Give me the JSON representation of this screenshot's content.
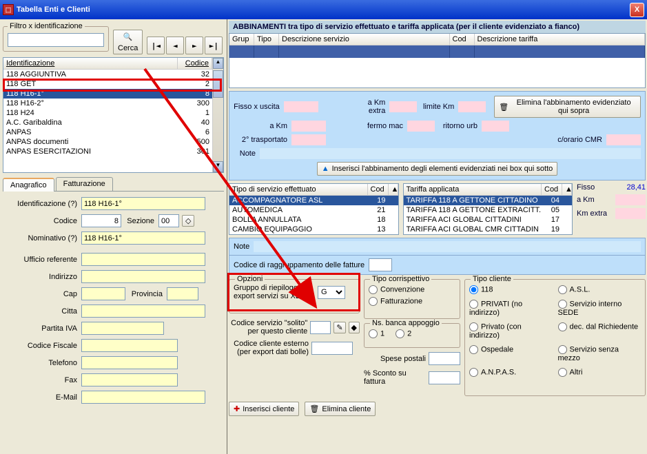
{
  "title": "Tabella Enti e Clienti",
  "filter": {
    "legend": "Filtro x identificazione",
    "search": "Cerca"
  },
  "nav": [
    "|◄",
    "◄",
    "►",
    "►|"
  ],
  "list": {
    "h_ident": "Identificazione",
    "h_code": "Codice",
    "rows": [
      {
        "ident": "118 AGGIUNTIVA",
        "code": "32"
      },
      {
        "ident": "118 GET",
        "code": "2"
      },
      {
        "ident": "118 H16-1°",
        "code": "8",
        "sel": true
      },
      {
        "ident": "118 H16-2°",
        "code": "300"
      },
      {
        "ident": "118 H24",
        "code": "1"
      },
      {
        "ident": "A.C. Garibaldina",
        "code": "40"
      },
      {
        "ident": "ANPAS",
        "code": "6"
      },
      {
        "ident": "ANPAS documenti",
        "code": "500"
      },
      {
        "ident": "ANPAS ESERCITAZIONI",
        "code": "301"
      }
    ]
  },
  "tabs": {
    "t1": "Anagrafico",
    "t2": "Fatturazione"
  },
  "form": {
    "ident_l": "Identificazione (?)",
    "ident_v": "118 H16-1°",
    "code_l": "Codice",
    "code_v": "8",
    "sez_l": "Sezione",
    "sez_v": "00",
    "nom_l": "Nominativo (?)",
    "nom_v": "118 H16-1°",
    "uff_l": "Ufficio referente",
    "ind_l": "Indirizzo",
    "cap_l": "Cap",
    "prov_l": "Provincia",
    "citta_l": "Citta",
    "piva_l": "Partita IVA",
    "cf_l": "Codice Fiscale",
    "tel_l": "Telefono",
    "fax_l": "Fax",
    "email_l": "E-Mail"
  },
  "ab": {
    "title": "ABBINAMENTI tra tipo di servizio effettuato e tariffa applicata (per il cliente evidenziato a fianco)",
    "cols": {
      "g": "Grup",
      "t": "Tipo",
      "ds": "Descrizione servizio",
      "c": "Cod",
      "dt": "Descrizione tariffa"
    },
    "fisso": "Fisso x uscita",
    "akm": "a Km",
    "kmx": "a Km extra",
    "lim": "limite Km",
    "trasp": "2° trasportato",
    "fermo": "fermo mac",
    "rit": "ritorno urb",
    "cor": "c/orario CMR",
    "note": "Note",
    "del": "Elimina l'abbinamento evidenziato qui sopra",
    "ins": "Inserisci l'abbinamento degli elementi evidenziati nei box qui sotto"
  },
  "svc": {
    "h1": "Tipo di servizio effettuato",
    "hc": "Cod",
    "rows": [
      {
        "d": "ACCOMPAGNATORE ASL",
        "c": "19",
        "sel": true
      },
      {
        "d": "AUTOMEDICA",
        "c": "21"
      },
      {
        "d": "BOLLA ANNULLATA",
        "c": "18"
      },
      {
        "d": "CAMBIO EQUIPAGGIO",
        "c": "13"
      }
    ]
  },
  "tar": {
    "h1": "Tariffa applicata",
    "hc": "Cod",
    "rows": [
      {
        "d": "TARIFFA 118 A GETTONE CITTADINO",
        "c": "04",
        "sel": true
      },
      {
        "d": "TARIFFA 118 A GETTONE EXTRACITT.",
        "c": "05"
      },
      {
        "d": "TARIFFA ACI GLOBAL CITTADINI",
        "c": "17"
      },
      {
        "d": "TARIFFA ACI GLOBAL CMR CITTADIN",
        "c": "19"
      }
    ]
  },
  "fix": {
    "fisso_l": "Fisso",
    "fisso_v": "28,41",
    "akm_l": "a Km",
    "kmx_l": "Km extra"
  },
  "nb": {
    "note": "Note",
    "codr": "Codice di raggruppamento delle fatture"
  },
  "opt": {
    "leg": "Opzioni",
    "grp": "Gruppo di riepilogo per export servizi su XLS",
    "grp_v": "G",
    "cs": "Codice servizio \"solito\" per questo cliente",
    "cce": "Codice cliente esterno (per export dati bolle)",
    "sp": "Spese postali",
    "sc": "% Sconto su fattura"
  },
  "tc": {
    "leg": "Tipo corrispettivo",
    "c": "Convenzione",
    "f": "Fatturazione",
    "nb": "Ns. banca appoggio",
    "o1": "1",
    "o2": "2"
  },
  "cli": {
    "leg": "Tipo cliente",
    "o": [
      "118",
      "A.S.L.",
      "PRIVATI (no indirizzo)",
      "Servizio interno SEDE",
      "Privato (con indirizzo)",
      "dec. dal Richiedente",
      "Ospedale",
      "Servizio senza mezzo",
      "A.N.P.A.S.",
      "Altri"
    ]
  },
  "bot": {
    "ins": "Inserisci cliente",
    "del": "Elimina cliente"
  }
}
